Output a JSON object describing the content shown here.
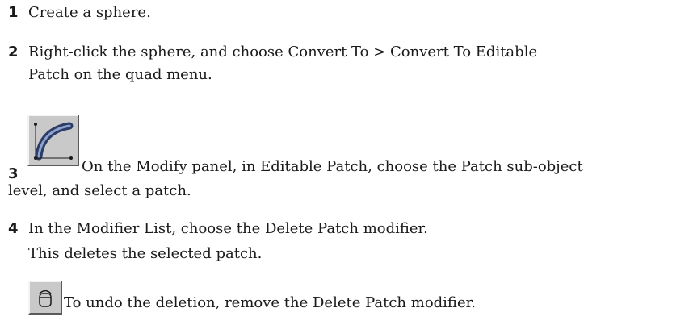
{
  "steps": [
    {
      "number": "1",
      "lines": [
        "Create a sphere."
      ]
    },
    {
      "number": "2",
      "lines": [
        "Right-click the sphere, and choose Convert To > Convert To Editable",
        "Patch on the quad menu."
      ]
    },
    {
      "number": "3",
      "icon": "patch-subobject-icon",
      "lines": [
        "On the Modify panel, in Editable Patch, choose the Patch sub-object",
        "level, and select a patch."
      ]
    },
    {
      "number": "4",
      "lines": [
        "In the Modifier List, choose the Delete Patch modifier.",
        "This deletes the selected patch."
      ]
    }
  ],
  "tip": {
    "icon": "remove-modifier-trash-icon",
    "text": "To undo the deletion, remove the Delete Patch modifier."
  }
}
